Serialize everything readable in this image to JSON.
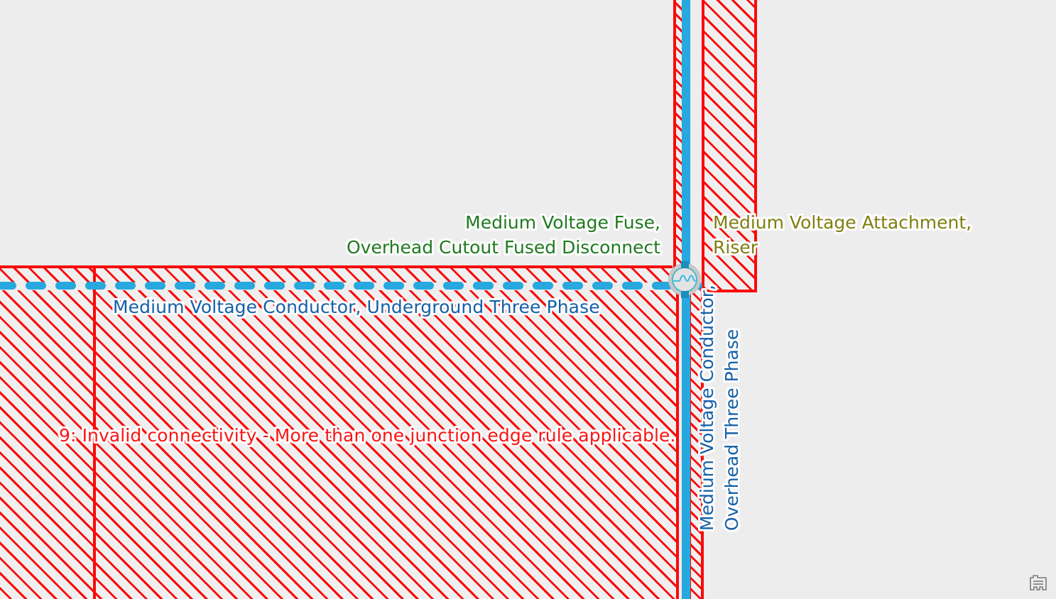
{
  "map": {
    "background_color": "#ededed",
    "error_color": "#fa0a0a",
    "conductor_color": "#27a8df"
  },
  "labels": {
    "fuse": {
      "line1": "Medium Voltage Fuse,",
      "line2": "Overhead Cutout Fused Disconnect",
      "color": "#1f7a1f"
    },
    "riser": {
      "line1": "Medium Voltage Attachment,",
      "line2": "Riser",
      "color": "#7f7f11"
    },
    "underground_conductor": {
      "text": "Medium Voltage Conductor, Underground Three Phase",
      "color": "#1560a8"
    },
    "overhead_conductor": {
      "line1": "Medium Voltage Conductor,",
      "line2": "Overhead Three Phase",
      "color": "#1560a8"
    },
    "error": {
      "text": "9: Invalid connectivity - More than one junction edge rule applicable.",
      "color": "#fa1414"
    }
  },
  "symbols": {
    "junction_device": "fused-disconnect-symbol",
    "corner": "basemap-legend-icon"
  }
}
